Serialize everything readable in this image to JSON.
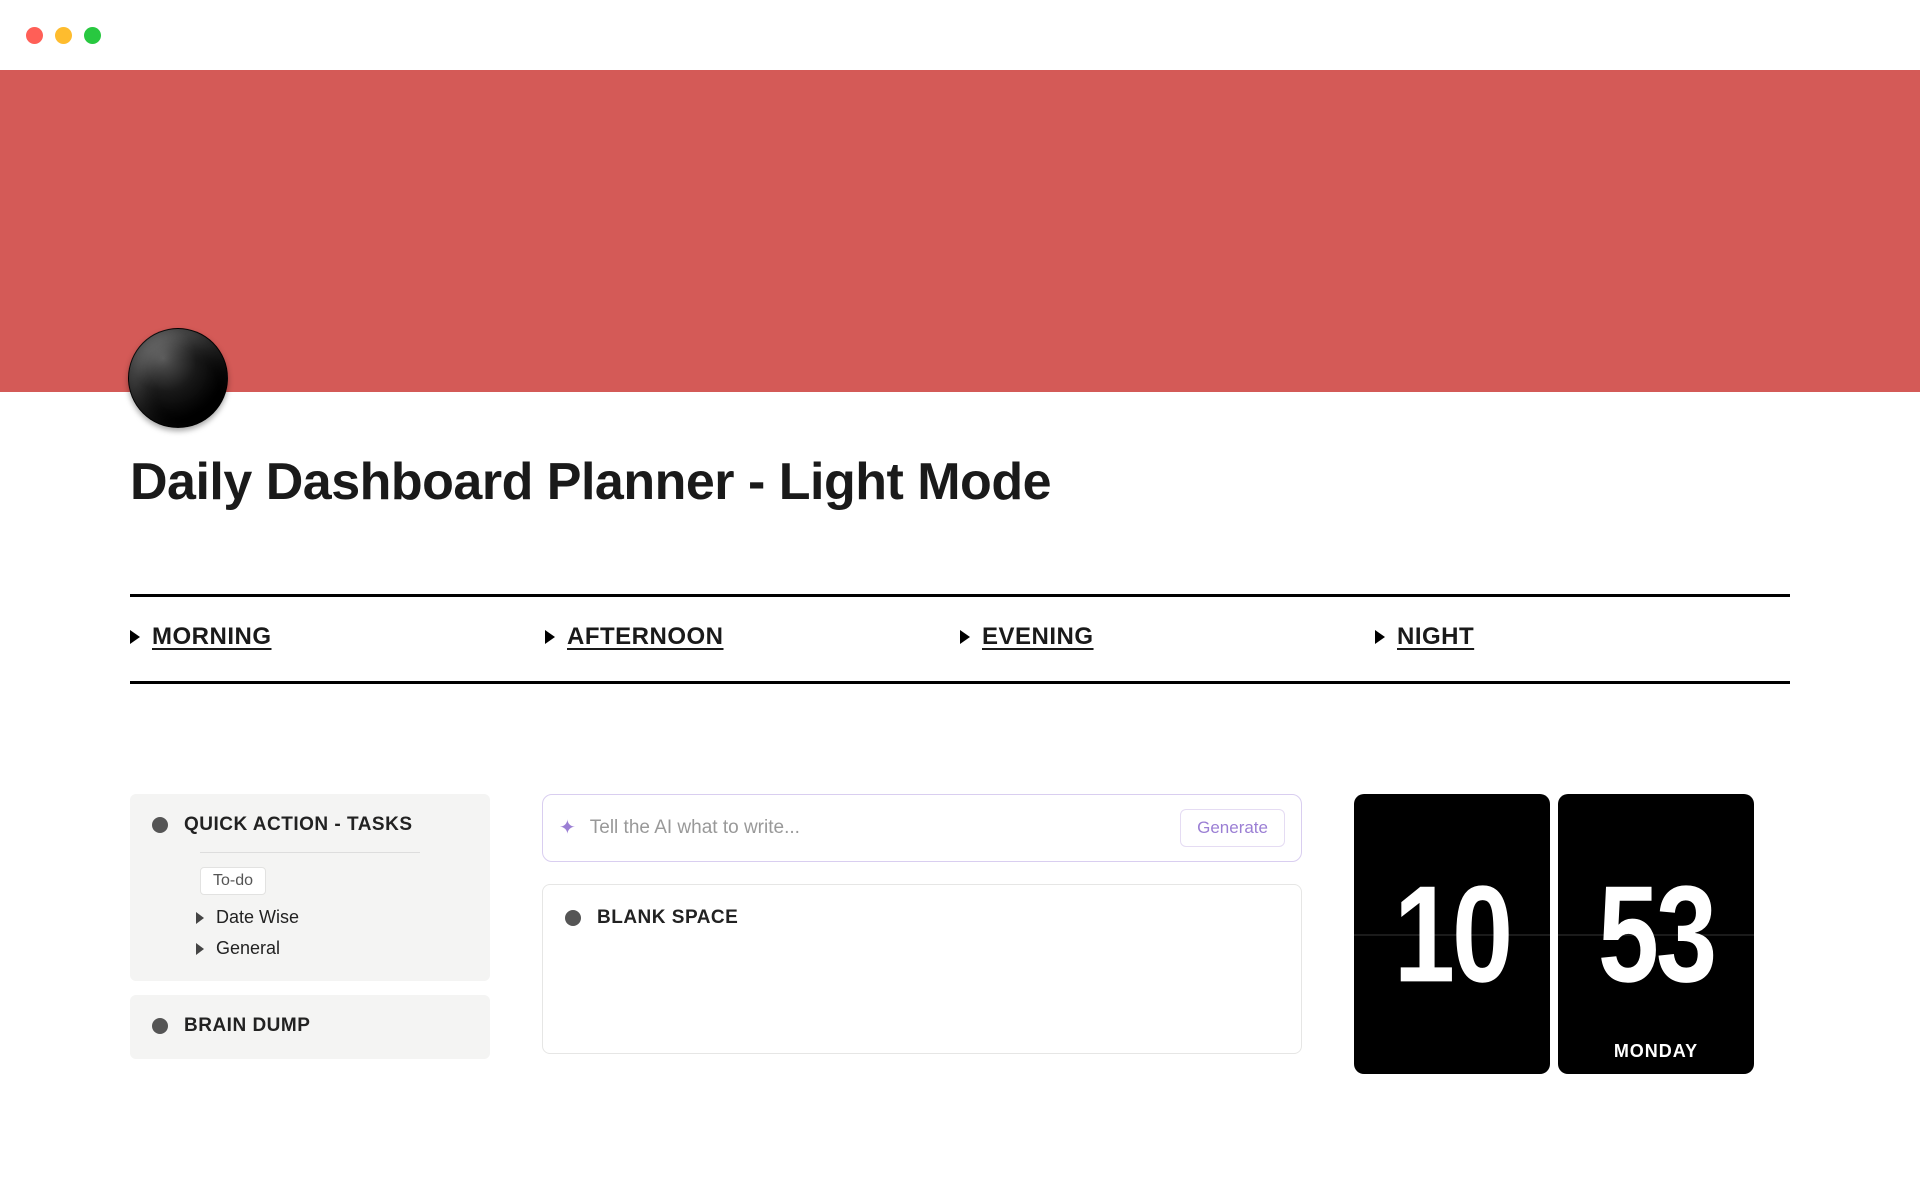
{
  "page": {
    "title": "Daily Dashboard Planner - Light Mode"
  },
  "cover": {
    "color": "#d45a57"
  },
  "time_sections": [
    {
      "label": "MORNING"
    },
    {
      "label": "AFTERNOON"
    },
    {
      "label": "EVENING"
    },
    {
      "label": "NIGHT"
    }
  ],
  "quick_action": {
    "title": "QUICK ACTION - TASKS",
    "badge": "To-do",
    "items": [
      {
        "label": "Date Wise"
      },
      {
        "label": "General"
      }
    ]
  },
  "brain_dump": {
    "title": "BRAIN DUMP"
  },
  "ai": {
    "placeholder": "Tell the AI what to write...",
    "button": "Generate"
  },
  "blank_space": {
    "title": "BLANK SPACE"
  },
  "clock": {
    "hours": "10",
    "minutes": "53",
    "day": "MONDAY"
  }
}
